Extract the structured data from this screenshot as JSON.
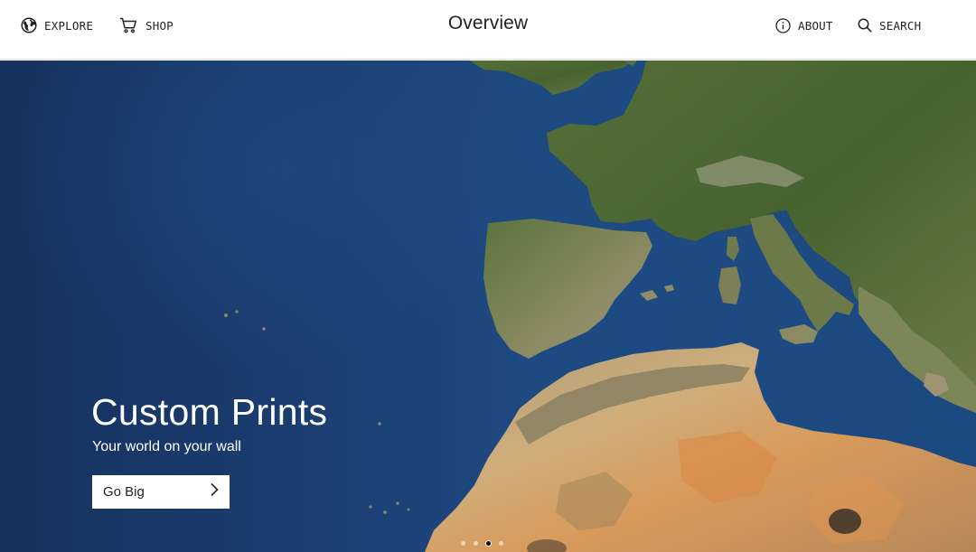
{
  "header": {
    "title": "Overview",
    "nav_left": [
      {
        "label": "EXPLORE",
        "icon": "globe-icon"
      },
      {
        "label": "SHOP",
        "icon": "cart-icon"
      }
    ],
    "nav_right": [
      {
        "label": "ABOUT",
        "icon": "info-icon"
      },
      {
        "label": "SEARCH",
        "icon": "search-icon"
      }
    ]
  },
  "hero": {
    "title": "Custom Prints",
    "subtitle": "Your world on your wall",
    "cta_label": "Go Big",
    "cta_icon": "chevron-right-icon",
    "carousel": {
      "count": 4,
      "active_index": 2
    }
  },
  "colors": {
    "ocean": "#1c3f73",
    "land_green": "#4f6e3a",
    "desert": "#c99a5e",
    "text_dark": "#222222"
  }
}
